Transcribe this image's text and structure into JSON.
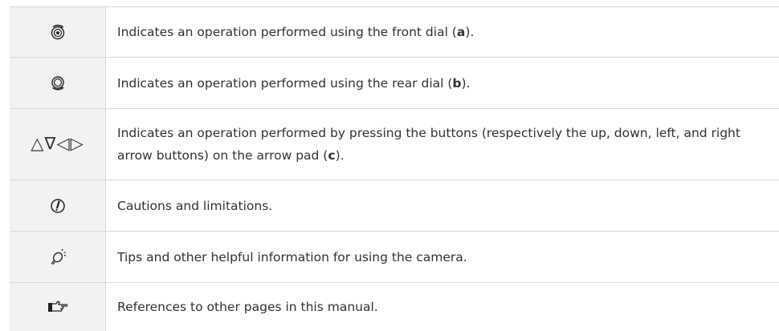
{
  "rows": [
    {
      "icon": "front-dial-icon",
      "text_before": "Indicates an operation performed using the front dial (",
      "bold": "a",
      "text_after": ")."
    },
    {
      "icon": "rear-dial-icon",
      "text_before": "Indicates an operation performed using the rear dial (",
      "bold": "b",
      "text_after": ")."
    },
    {
      "icon": "arrow-pad-icons",
      "icon_glyphs": "△∇◁▷",
      "text_before": "Indicates an operation performed by pressing the buttons (respectively the up, down, left, and right arrow buttons) on the arrow pad (",
      "bold": "c",
      "text_after": ")."
    },
    {
      "icon": "caution-icon",
      "text_before": "Cautions and limitations.",
      "bold": "",
      "text_after": ""
    },
    {
      "icon": "tip-lightbulb-icon",
      "text_before": "Tips and other helpful information for using the camera.",
      "bold": "",
      "text_after": ""
    },
    {
      "icon": "reference-hand-icon",
      "text_before": "References to other pages in this manual.",
      "bold": "",
      "text_after": ""
    }
  ]
}
